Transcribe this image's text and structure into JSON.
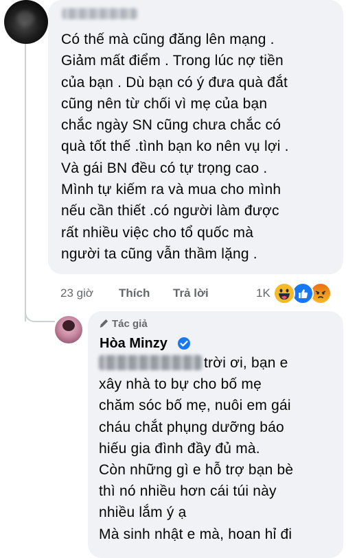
{
  "comment": {
    "lines": [
      "Có thế mà cũng đăng lên mạng .",
      "Giảm mất điểm . Trong lúc nợ tiền",
      "của bạn . Dù bạn có ý đưa quà đắt",
      "cũng nên từ chối vì mẹ của bạn",
      "chắc ngày SN cũng chưa chắc có",
      "quà tốt thế .tình bạn ko nên vụ lợi .",
      "Và gái BN đều có tự trọng cao .",
      "Mình tự kiếm ra và mua cho mình",
      "nếu cần thiết .có người làm được",
      "rất nhiều việc cho tổ quốc mà",
      "người ta cũng vẫn thầm lặng ."
    ],
    "time": "23 giờ",
    "like_label": "Thích",
    "reply_label": "Trả lời",
    "reaction_count": "1K",
    "reactions": [
      "haha-icon",
      "like-icon",
      "angry-icon"
    ]
  },
  "reply": {
    "author_badge": "Tác giả",
    "author_name": "Hòa Minzy",
    "lines": [
      "trời ơi, bạn e",
      "xây nhà to bự cho bố mẹ",
      "chăm sóc bố mẹ, nuôi em gái",
      "cháu chắt phụng dưỡng báo",
      "hiếu gia đình đầy đủ mà.",
      "Còn những gì e hỗ trợ bạn bè",
      "thì nó nhiều hơn cái túi này",
      "nhiều lắm ý ạ",
      "Mà sinh nhật e mà, hoan hỉ đi"
    ]
  },
  "colors": {
    "bubble": "#f0f2f5",
    "meta": "#65676b",
    "verified": "#1877f2"
  }
}
